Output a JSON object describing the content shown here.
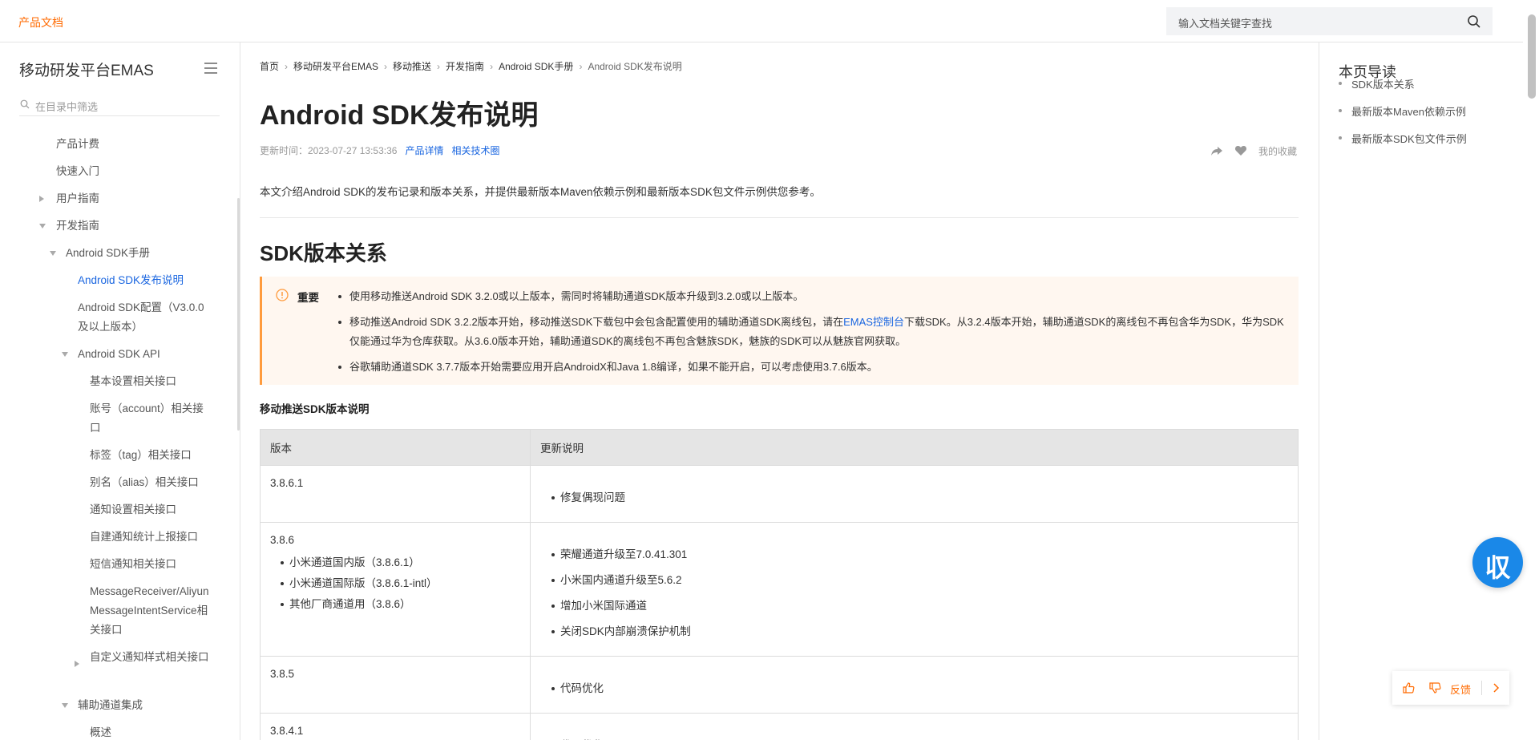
{
  "topbar": {
    "brand": "产品文档",
    "search_placeholder": "输入文档关键字查找"
  },
  "sidebar": {
    "title": "移动研发平台EMAS",
    "filter_placeholder": "在目录中筛选",
    "items": [
      {
        "label": "产品计费",
        "caret": "none"
      },
      {
        "label": "快速入门",
        "caret": "none"
      },
      {
        "label": "用户指南",
        "caret": "right"
      },
      {
        "label": "开发指南",
        "caret": "down"
      },
      {
        "label": "Android SDK手册",
        "caret": "down"
      },
      {
        "label": "Android SDK发布说明",
        "caret": "none",
        "active": true
      },
      {
        "label": "Android SDK配置（V3.0.0及以上版本）",
        "caret": "none"
      },
      {
        "label": "Android SDK API",
        "caret": "down"
      },
      {
        "label": "基本设置相关接口",
        "caret": "none"
      },
      {
        "label": "账号（account）相关接口",
        "caret": "none"
      },
      {
        "label": "标签（tag）相关接口",
        "caret": "none"
      },
      {
        "label": "别名（alias）相关接口",
        "caret": "none"
      },
      {
        "label": "通知设置相关接口",
        "caret": "none"
      },
      {
        "label": "自建通知统计上报接口",
        "caret": "none"
      },
      {
        "label": "短信通知相关接口",
        "caret": "none"
      },
      {
        "label": "MessageReceiver/AliyunMessageIntentService相关接口",
        "caret": "none"
      },
      {
        "label": "自定义通知样式相关接口",
        "caret": "right"
      },
      {
        "label": "辅助通道集成",
        "caret": "down"
      },
      {
        "label": "概述",
        "caret": "none"
      }
    ]
  },
  "breadcrumb": [
    "首页",
    "移动研发平台EMAS",
    "移动推送",
    "开发指南",
    "Android SDK手册",
    "Android SDK发布说明"
  ],
  "article": {
    "title": "Android SDK发布说明",
    "updated": "更新时间：2023-07-27 13:53:36",
    "link_product": "产品详情",
    "link_tech": "相关技术圈",
    "favorite": "我的收藏",
    "intro": "本文介绍Android SDK的发布记录和版本关系，并提供最新版本Maven依赖示例和最新版本SDK包文件示例供您参考。",
    "section_title": "SDK版本关系",
    "notice": {
      "label": "重要",
      "item1": "使用移动推送Android SDK 3.2.0或以上版本，需同时将辅助通道SDK版本升级到3.2.0或以上版本。",
      "item2_before": "移动推送Android SDK 3.2.2版本开始，移动推送SDK下载包中会包含配置使用的辅助通道SDK离线包，请在",
      "item2_link": "EMAS控制台",
      "item2_after": "下载SDK。从3.2.4版本开始，辅助通道SDK的离线包不再包含华为SDK，华为SDK仅能通过华为仓库获取。从3.6.0版本开始，辅助通道SDK的离线包不再包含魅族SDK，魅族的SDK可以从魅族官网获取。",
      "item3": "谷歌辅助通道SDK 3.7.7版本开始需要应用开启AndroidX和Java 1.8编译，如果不能开启，可以考虑使用3.7.6版本。"
    },
    "table_caption": "移动推送SDK版本说明",
    "table": {
      "headers": [
        "版本",
        "更新说明"
      ],
      "rows": [
        {
          "version": "3.8.6.1",
          "sub": [],
          "updates": [
            "修复偶现问题"
          ]
        },
        {
          "version": "3.8.6",
          "sub": [
            "小米通道国内版（3.8.6.1）",
            "小米通道国际版（3.8.6.1-intl）",
            "其他厂商通道用（3.8.6）"
          ],
          "updates": [
            "荣耀通道升级至7.0.41.301",
            "小米国内通道升级至5.6.2",
            "增加小米国际通道",
            "关闭SDK内部崩溃保护机制"
          ]
        },
        {
          "version": "3.8.5",
          "sub": [],
          "updates": [
            "代码优化"
          ]
        },
        {
          "version": "3.8.4.1",
          "sub": [],
          "updates": [
            "代码优化"
          ]
        }
      ]
    }
  },
  "toc": {
    "title": "本页导读",
    "items": [
      "SDK版本关系",
      "最新版本Maven依赖示例",
      "最新版本SDK包文件示例"
    ]
  },
  "floating": {
    "glyph": "収",
    "feedback_label": "反馈"
  },
  "colors": {
    "brand": "#ff6a00",
    "link": "#1a66e0",
    "notice_bg": "#fff7f0",
    "notice_border": "#ff9b3d",
    "float_bg": "#1a88e8"
  }
}
